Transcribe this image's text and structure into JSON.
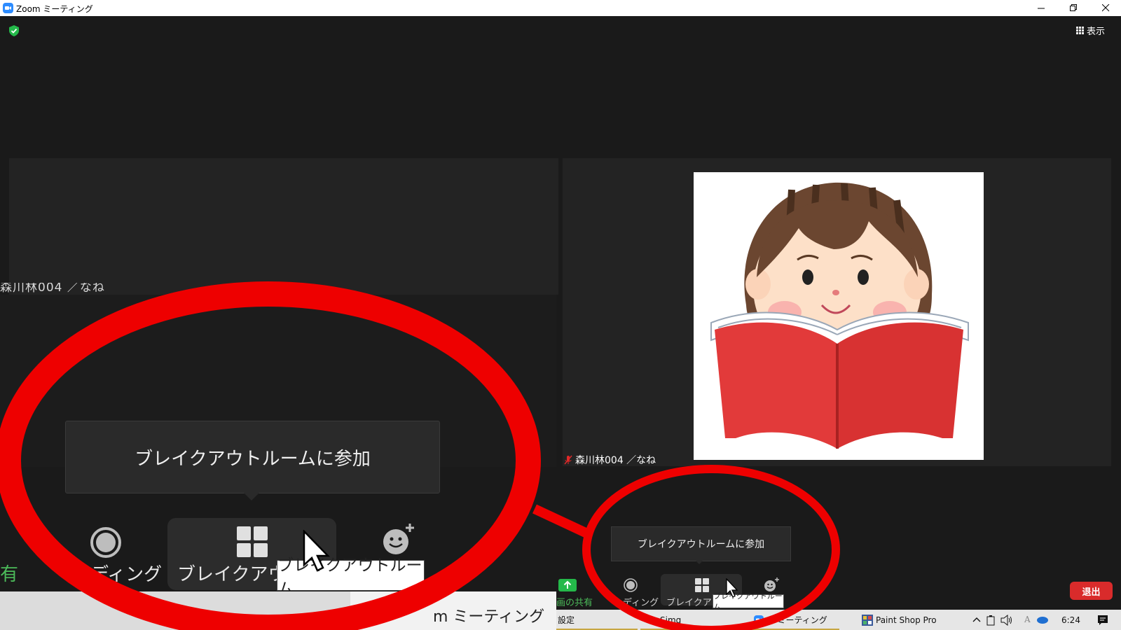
{
  "window": {
    "title": "Zoom ミーティング",
    "minimize_icon": "minimize-icon",
    "restore_icon": "restore-icon",
    "close_icon": "close-icon"
  },
  "header": {
    "view_label": "表示"
  },
  "participants": {
    "left_name": "森川林004 ／なね",
    "right_name": "森川林004 ／なね"
  },
  "zoomed": {
    "tooltip": "ブレイクアウトルームに参加",
    "share_partial": "有",
    "recording_partial": "ーディング",
    "breakout_partial": "ブレイクアウト",
    "hover_tooltip": "ブレイクアウトルーム",
    "taskbar_partial_left": "Simg",
    "taskbar_partial_right": "m ミーティング"
  },
  "toolbar": {
    "tooltip": "ブレイクアウトルームに参加",
    "share_partial": "画の共有",
    "recording_partial": "ーディング",
    "breakout_partial": "ブレイクアウト",
    "hover_tooltip": "ブレイクアウトルーム",
    "leave_label": "退出"
  },
  "taskbar": {
    "item1": "設定",
    "item2": "Simg",
    "item3": "m ミーティング",
    "item4": "Paint Shop Pro",
    "ime": "A",
    "time": "6:24"
  },
  "colors": {
    "annotation_red": "#ee0000",
    "leave_red": "#d92b2b",
    "share_green": "#24b94a"
  }
}
